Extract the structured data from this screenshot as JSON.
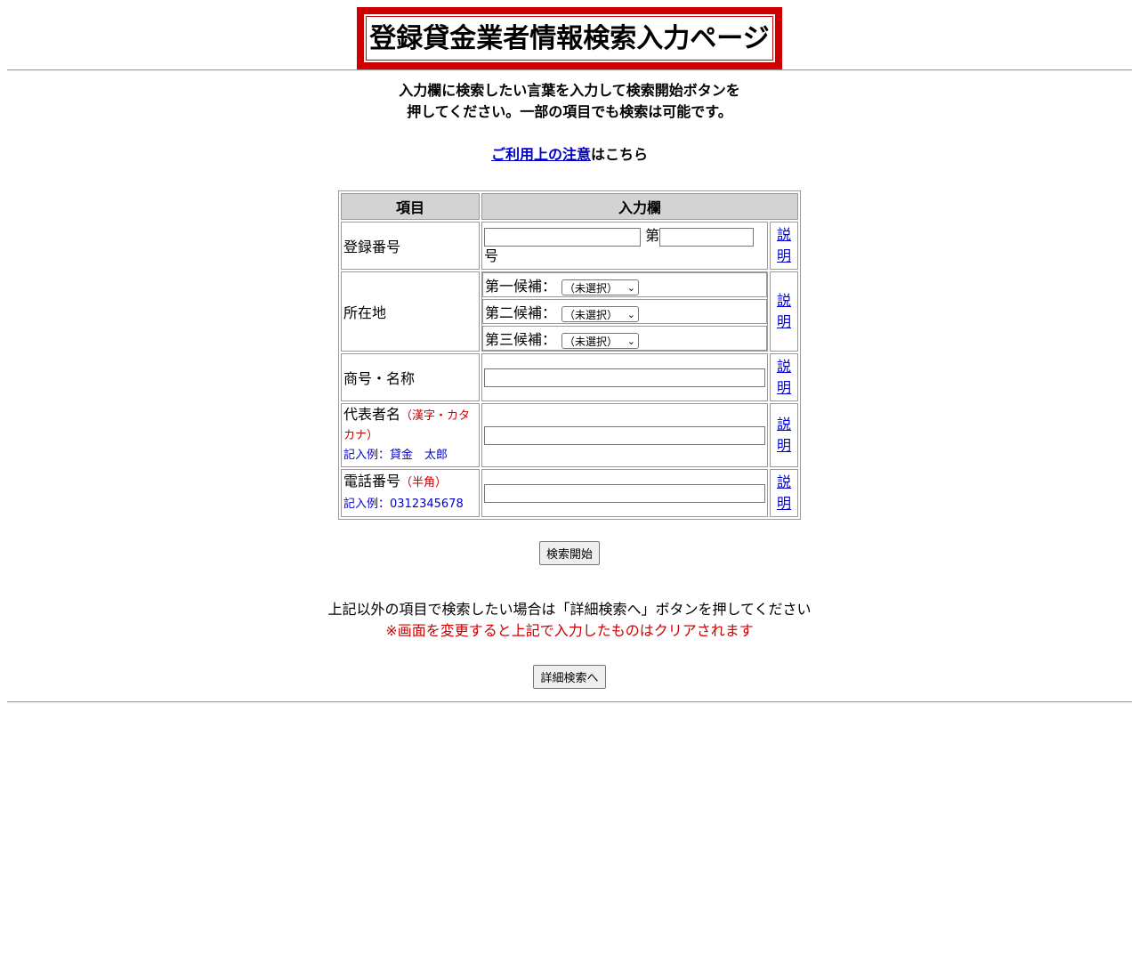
{
  "page_title": "登録貸金業者情報検索入力ページ",
  "instruction_line1": "入力欄に検索したい言葉を入力して検索開始ボタンを",
  "instruction_line2": "押してください。一部の項目でも検索は可能です。",
  "notice_link": "ご利用上の注意",
  "notice_suffix": "はこちら",
  "table": {
    "header_item": "項目",
    "header_input": "入力欄",
    "help_label_1": "説",
    "help_label_2": "明",
    "reg_number": {
      "label": "登録番号",
      "prefix_dai": "第",
      "suffix_go": "号"
    },
    "location": {
      "label": "所在地",
      "candidates": [
        {
          "label": "第一候補：",
          "selected": "（未選択）"
        },
        {
          "label": "第二候補：",
          "selected": "（未選択）"
        },
        {
          "label": "第三候補：",
          "selected": "（未選択）"
        }
      ]
    },
    "trade_name": {
      "label": "商号・名称"
    },
    "representative": {
      "label": "代表者名",
      "note": "（漢字・カタカナ）",
      "example": "記入例：貸金　太郎"
    },
    "phone": {
      "label": "電話番号",
      "note": "（半角）",
      "example": "記入例：0312345678"
    }
  },
  "search_button": "検索開始",
  "detail_text": "上記以外の項目で検索したい場合は「詳細検索へ」ボタンを押してください",
  "detail_warning": "※画面を変更すると上記で入力したものはクリアされます",
  "detail_button": "詳細検索へ",
  "colors": {
    "title_border": "#cc0000",
    "link": "#0000cc",
    "header_bg": "#d3d3d3",
    "warning": "#cc0000"
  }
}
